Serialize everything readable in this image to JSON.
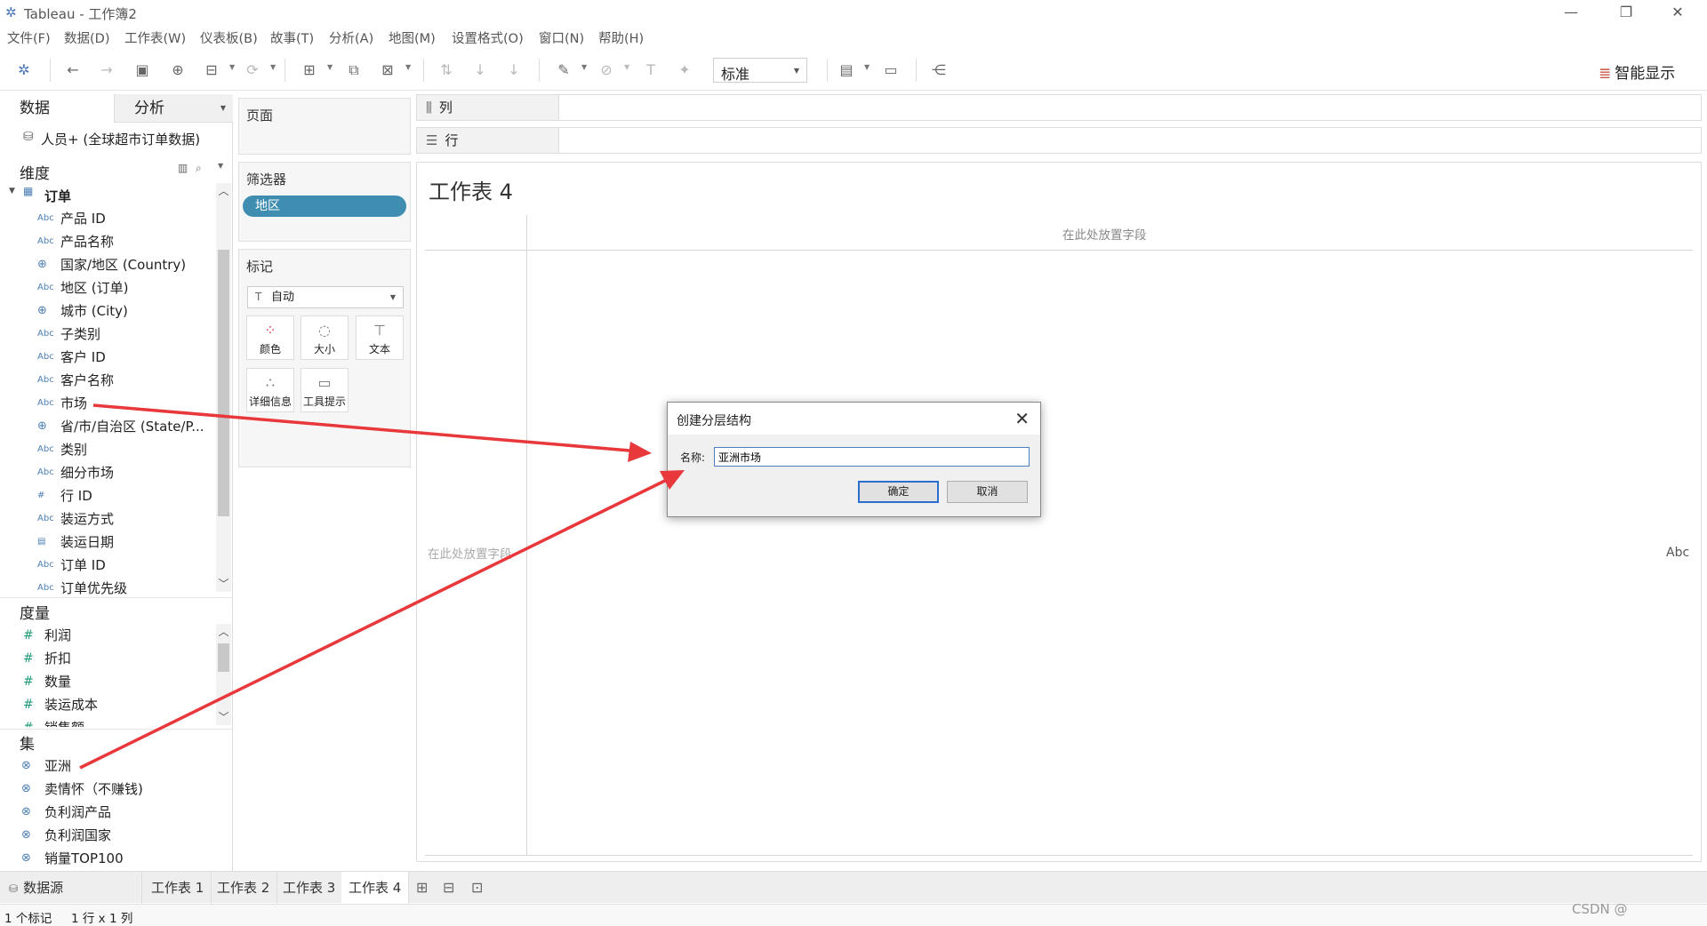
{
  "window": {
    "title": "Tableau - 工作簿2"
  },
  "menu": [
    "文件(F)",
    "数据(D)",
    "工作表(W)",
    "仪表板(B)",
    "故事(T)",
    "分析(A)",
    "地图(M)",
    "设置格式(O)",
    "窗口(N)",
    "帮助(H)"
  ],
  "toolbar": {
    "fit_value": "标准",
    "show_me": "智能显示"
  },
  "data_pane": {
    "tab_data": "数据",
    "tab_analysis": "分析",
    "datasource": "人员+ (全球超市订单数据)",
    "dimensions_label": "维度",
    "folder": "订单",
    "dimensions": [
      {
        "type": "Abc",
        "name": "产品 ID"
      },
      {
        "type": "Abc",
        "name": "产品名称"
      },
      {
        "type": "geo",
        "name": "国家/地区 (Country)"
      },
      {
        "type": "Abc",
        "name": "地区 (订单)"
      },
      {
        "type": "geo",
        "name": "城市 (City)"
      },
      {
        "type": "Abc",
        "name": "子类别"
      },
      {
        "type": "Abc",
        "name": "客户 ID"
      },
      {
        "type": "Abc",
        "name": "客户名称"
      },
      {
        "type": "Abc",
        "name": "市场"
      },
      {
        "type": "geo",
        "name": "省/市/自治区 (State/P..."
      },
      {
        "type": "Abc",
        "name": "类别"
      },
      {
        "type": "Abc",
        "name": "细分市场"
      },
      {
        "type": "#",
        "name": "行 ID"
      },
      {
        "type": "Abc",
        "name": "装运方式"
      },
      {
        "type": "date",
        "name": "装运日期"
      },
      {
        "type": "Abc",
        "name": "订单 ID"
      },
      {
        "type": "Abc",
        "name": "订单优先级"
      }
    ],
    "measures_label": "度量",
    "measures": [
      "利润",
      "折扣",
      "数量",
      "装运成本",
      "销售额"
    ],
    "sets_label": "集",
    "sets": [
      "亚洲",
      "卖情怀（不赚钱)",
      "负利润产品",
      "负利润国家",
      "销量TOP100"
    ]
  },
  "shelves": {
    "pages": "页面",
    "filters": "筛选器",
    "filter_pill": "地区",
    "marks": "标记",
    "marks_type": "自动",
    "mark_buttons": [
      "颜色",
      "大小",
      "文本",
      "详细信息",
      "工具提示"
    ],
    "columns": "列",
    "rows": "行"
  },
  "view": {
    "title": "工作表 4",
    "drop_columns": "在此处放置字段",
    "drop_rows": "在此处放置字段",
    "abc": "Abc"
  },
  "dialog": {
    "title": "创建分层结构",
    "name_label": "名称:",
    "name_value": "亚洲市场",
    "ok": "确定",
    "cancel": "取消"
  },
  "sheet_tabs": {
    "datasource": "数据源",
    "sheets": [
      "工作表 1",
      "工作表 2",
      "工作表 3",
      "工作表 4"
    ]
  },
  "status": {
    "marks": "1 个标记",
    "dims": "1 行 x 1 列"
  },
  "watermark": "CSDN @"
}
